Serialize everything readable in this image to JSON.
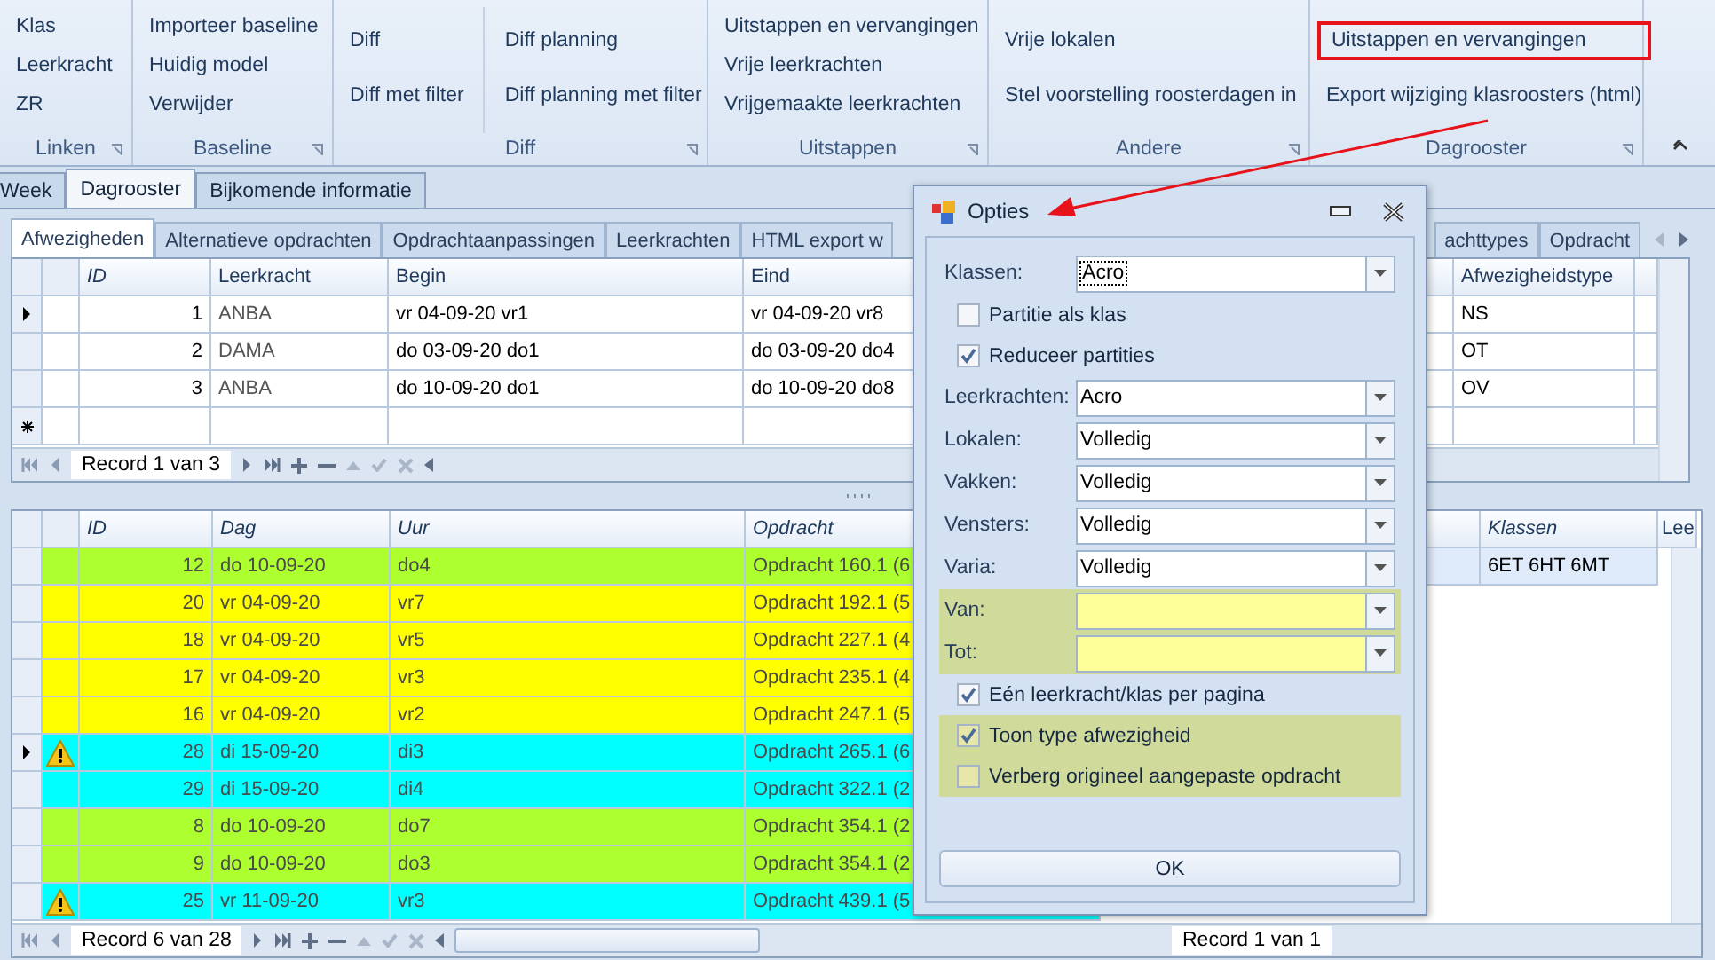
{
  "ribbon": {
    "groups": [
      {
        "label": "Linken",
        "columns": [
          [
            {
              "label": "Klas",
              "annotated": false
            },
            {
              "label": "Leerkracht",
              "annotated": false
            },
            {
              "label": "ZR",
              "annotated": false
            }
          ]
        ]
      },
      {
        "label": "Baseline",
        "columns": [
          [
            {
              "label": "Importeer baseline",
              "annotated": false
            },
            {
              "label": "Huidig model",
              "annotated": false
            },
            {
              "label": "Verwijder",
              "annotated": false
            }
          ]
        ]
      },
      {
        "label": "Diff",
        "columns": [
          [
            {
              "label": "Diff",
              "annotated": false
            },
            {
              "label": "Diff met filter",
              "annotated": false
            }
          ],
          [
            {
              "label": "Diff planning",
              "annotated": false
            },
            {
              "label": "Diff planning met filter",
              "annotated": false
            }
          ]
        ]
      },
      {
        "label": "Uitstappen",
        "columns": [
          [
            {
              "label": "Uitstappen en vervangingen",
              "annotated": false
            },
            {
              "label": "Vrije leerkrachten",
              "annotated": false
            },
            {
              "label": "Vrijgemaakte leerkrachten",
              "annotated": false
            }
          ]
        ]
      },
      {
        "label": "Andere",
        "columns": [
          [
            {
              "label": "Vrije lokalen",
              "annotated": false
            },
            {
              "label": "Stel voorstelling roosterdagen in",
              "annotated": false
            }
          ]
        ]
      },
      {
        "label": "Dagrooster",
        "columns": [
          [
            {
              "label": "Uitstappen en vervangingen",
              "annotated": true
            },
            {
              "label": "Export wijziging klasroosters (html)",
              "annotated": false
            }
          ]
        ]
      }
    ]
  },
  "tabs": [
    {
      "label": "Week",
      "selected": false
    },
    {
      "label": "Dagrooster",
      "selected": true
    },
    {
      "label": "Bijkomende informatie",
      "selected": false
    }
  ],
  "sub_tabs": [
    {
      "label": "Afwezigheden",
      "selected": true
    },
    {
      "label": "Alternatieve opdrachten",
      "selected": false
    },
    {
      "label": "Opdrachtaanpassingen",
      "selected": false
    },
    {
      "label": "Leerkrachten",
      "selected": false
    },
    {
      "label": "HTML export w",
      "selected": false
    },
    {
      "label": "achttypes",
      "selected": false
    },
    {
      "label": "Opdracht",
      "selected": false
    }
  ],
  "absences_table": {
    "columns": [
      {
        "label": "ID",
        "italic": true
      },
      {
        "label": "Leerkracht",
        "italic": false
      },
      {
        "label": "Begin",
        "italic": false
      },
      {
        "label": "Eind",
        "italic": false
      },
      {
        "label": "Afwezigheidstype",
        "italic": false
      }
    ],
    "rows": [
      {
        "selected": true,
        "cells": [
          "1",
          "ANBA",
          "vr 04-09-20 vr1",
          "vr 04-09-20 vr8",
          "NS"
        ]
      },
      {
        "selected": false,
        "cells": [
          "2",
          "DAMA",
          "do 03-09-20 do1",
          "do 03-09-20 do4",
          "OT"
        ]
      },
      {
        "selected": false,
        "cells": [
          "3",
          "ANBA",
          "do 10-09-20 do1",
          "do 10-09-20 do8",
          "OV"
        ]
      }
    ],
    "navigator": "Record 1 van 3"
  },
  "lessons_table": {
    "columns": [
      {
        "label": "ID",
        "italic": true
      },
      {
        "label": "Dag",
        "italic": true
      },
      {
        "label": "Uur",
        "italic": true
      },
      {
        "label": "Opdracht",
        "italic": true
      }
    ],
    "rows": [
      {
        "selected": false,
        "warning": false,
        "color": "#adff2f",
        "cells": [
          "12",
          "do 10-09-20",
          "do4",
          "Opdracht 160.1 (6"
        ]
      },
      {
        "selected": false,
        "warning": false,
        "color": "#ffff00",
        "cells": [
          "20",
          "vr 04-09-20",
          "vr7",
          "Opdracht 192.1 (5"
        ]
      },
      {
        "selected": false,
        "warning": false,
        "color": "#ffff00",
        "cells": [
          "18",
          "vr 04-09-20",
          "vr5",
          "Opdracht 227.1 (4"
        ]
      },
      {
        "selected": false,
        "warning": false,
        "color": "#ffff00",
        "cells": [
          "17",
          "vr 04-09-20",
          "vr3",
          "Opdracht 235.1 (4"
        ]
      },
      {
        "selected": false,
        "warning": false,
        "color": "#ffff00",
        "cells": [
          "16",
          "vr 04-09-20",
          "vr2",
          "Opdracht 247.1 (5"
        ]
      },
      {
        "selected": true,
        "warning": true,
        "color": "#00ffff",
        "cells": [
          "28",
          "di 15-09-20",
          "di3",
          "Opdracht 265.1 (6"
        ]
      },
      {
        "selected": false,
        "warning": false,
        "color": "#00ffff",
        "cells": [
          "29",
          "di 15-09-20",
          "di4",
          "Opdracht 322.1 (2"
        ]
      },
      {
        "selected": false,
        "warning": false,
        "color": "#adff2f",
        "cells": [
          "8",
          "do 10-09-20",
          "do7",
          "Opdracht 354.1 (2"
        ]
      },
      {
        "selected": false,
        "warning": false,
        "color": "#adff2f",
        "cells": [
          "9",
          "do 10-09-20",
          "do3",
          "Opdracht 354.1 (2"
        ]
      },
      {
        "selected": false,
        "warning": true,
        "color": "#00ffff",
        "cells": [
          "25",
          "vr 11-09-20",
          "vr3",
          "Opdracht 439.1 (5"
        ]
      }
    ],
    "navigator": "Record 6 van 28"
  },
  "classes_table": {
    "columns": [
      {
        "label": "Klassen",
        "italic": true
      },
      {
        "label": "Lee",
        "italic": false
      }
    ],
    "rows": [
      {
        "selected": true,
        "cells": [
          "6ET 6HT 6MT"
        ]
      }
    ],
    "navigator": "Record 1 van 1"
  },
  "dialog": {
    "title": "Opties",
    "ok_button": "OK",
    "sections": [
      {
        "highlighted": false,
        "rows": [
          {
            "kind": "select",
            "label": "Klassen:",
            "value": "Acro",
            "focused": true
          },
          {
            "kind": "checkbox",
            "label": "Partitie als klas",
            "checked": false
          },
          {
            "kind": "checkbox",
            "label": "Reduceer partities",
            "checked": true
          },
          {
            "kind": "select",
            "label": "Leerkrachten:",
            "value": "Acro",
            "focused": false
          },
          {
            "kind": "select",
            "label": "Lokalen:",
            "value": "Volledig",
            "focused": false
          },
          {
            "kind": "select",
            "label": "Vakken:",
            "value": "Volledig",
            "focused": false
          },
          {
            "kind": "select",
            "label": "Vensters:",
            "value": "Volledig",
            "focused": false
          },
          {
            "kind": "select",
            "label": "Varia:",
            "value": "Volledig",
            "focused": false
          }
        ]
      },
      {
        "highlighted": true,
        "rows": [
          {
            "kind": "select",
            "label": "Van:"
          },
          {
            "kind": "select",
            "label": "Tot:"
          }
        ]
      },
      {
        "highlighted": false,
        "rows": [
          {
            "kind": "checkbox",
            "label": "Eén leerkracht/klas per pagina",
            "checked": true
          }
        ]
      },
      {
        "highlighted": true,
        "rows": [
          {
            "kind": "checkbox",
            "label": "Toon type afwezigheid",
            "checked": true
          },
          {
            "kind": "checkbox",
            "label": "Verberg origineel aangepaste opdracht",
            "checked": false
          }
        ]
      }
    ]
  }
}
